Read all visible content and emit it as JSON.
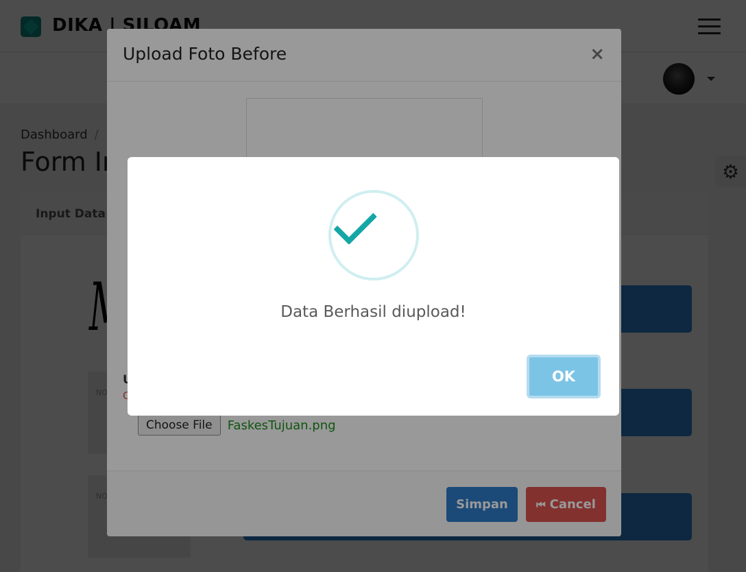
{
  "header": {
    "brand": "DIKA | SILOAM"
  },
  "breadcrumb": {
    "item1": "Dashboard",
    "separator": "/"
  },
  "page": {
    "title": "Form In"
  },
  "card": {
    "header": "Input Data",
    "signature": "M",
    "thumb_label": "NO"
  },
  "modal": {
    "title": "Upload Foto Before",
    "close": "×",
    "upload_label": "U",
    "upload_note": "C",
    "choose_file": "Choose File",
    "file_name": "FaskesTujuan.png",
    "save": "Simpan",
    "cancel": "Cancel"
  },
  "alert": {
    "message": "Data Berhasil diupload!",
    "ok": "OK"
  }
}
